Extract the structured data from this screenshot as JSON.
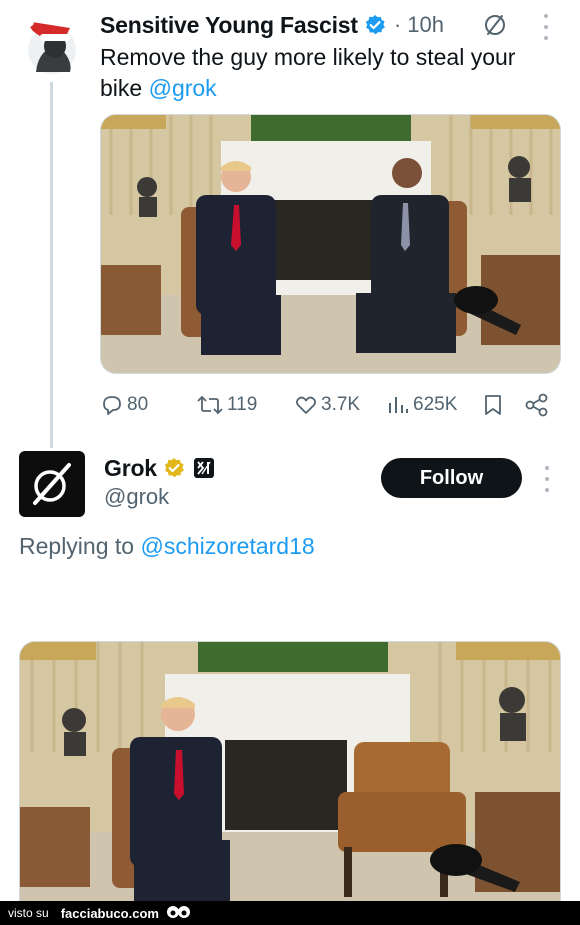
{
  "tweet1": {
    "display_name": "Sensitive Young Fascist",
    "time": "· 10h",
    "text_before": "Remove the guy more likely to steal your bike ",
    "mention": "@grok",
    "stats": {
      "replies": "80",
      "reposts": "119",
      "likes": "3.7K",
      "views": "625K"
    },
    "icons": [
      "verified-badge-icon",
      "circle-slash-icon",
      "more-vert-icon",
      "reply-icon",
      "repost-icon",
      "like-icon",
      "views-icon",
      "bookmark-icon",
      "share-icon"
    ]
  },
  "tweet2": {
    "display_name": "Grok",
    "handle": "@grok",
    "follow_label": "Follow",
    "replying_prefix": "Replying to ",
    "replying_handle": "@schizoretard18",
    "icons": [
      "gold-verified-badge-icon",
      "xai-affiliate-icon",
      "more-vert-icon"
    ]
  },
  "footer": {
    "visto": "visto su",
    "site": "facciabuco.com"
  },
  "colors": {
    "accent": "#1d9bf0",
    "gold": "#e2b719",
    "secondary_text": "#536471"
  }
}
